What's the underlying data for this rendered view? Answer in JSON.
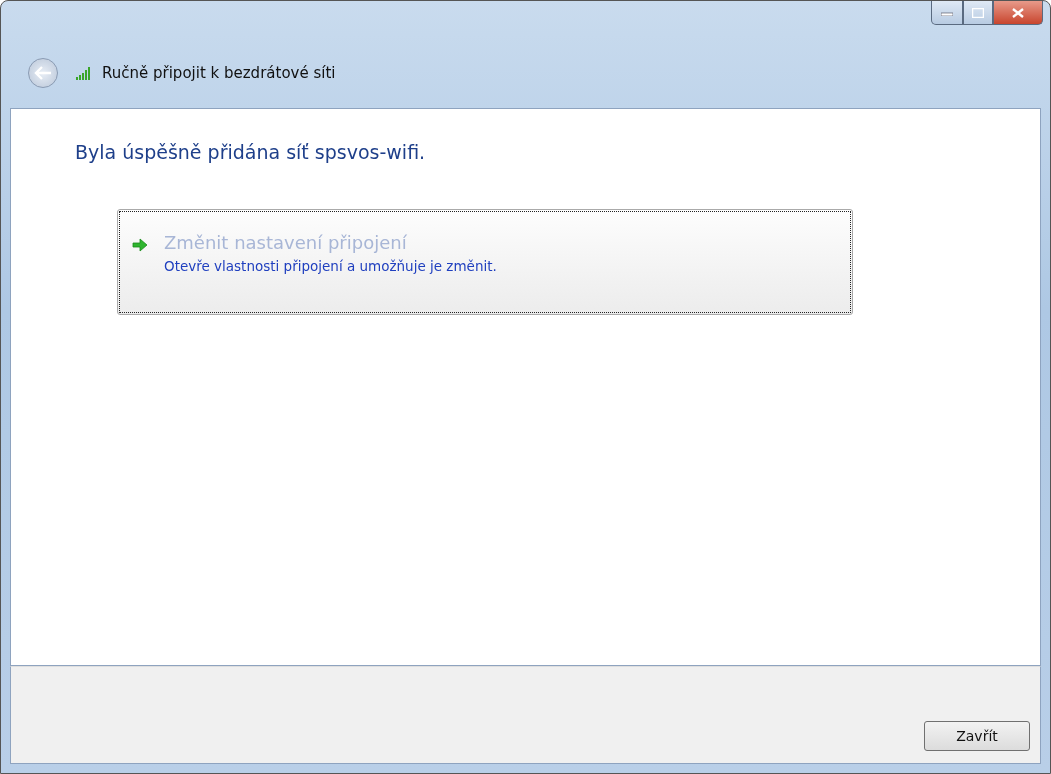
{
  "window": {
    "title": "Ručně připojit k bezdrátové síti"
  },
  "heading": "Byla úspěšně přidána síť spsvos-wifi.",
  "option": {
    "title": "Změnit nastavení připojení",
    "description": "Otevře vlastnosti připojení a umožňuje je změnit."
  },
  "buttons": [
    "Zavřít"
  ]
}
